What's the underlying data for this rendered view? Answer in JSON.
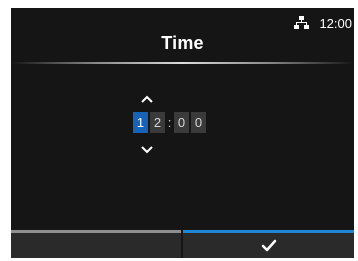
{
  "header": {
    "title": "Time",
    "clock": "12:00",
    "network_icon": "network-icon"
  },
  "editor": {
    "up_icon": "chevron-up-icon",
    "down_icon": "chevron-down-icon",
    "digits": [
      "1",
      "2",
      "0",
      "0"
    ],
    "separator": ":",
    "selected_index": 0
  },
  "footer": {
    "left_action": "",
    "confirm_icon": "checkmark-icon"
  },
  "colors": {
    "background": "#151515",
    "accent": "#1763b8",
    "confirm_bar": "#1f86d6"
  }
}
